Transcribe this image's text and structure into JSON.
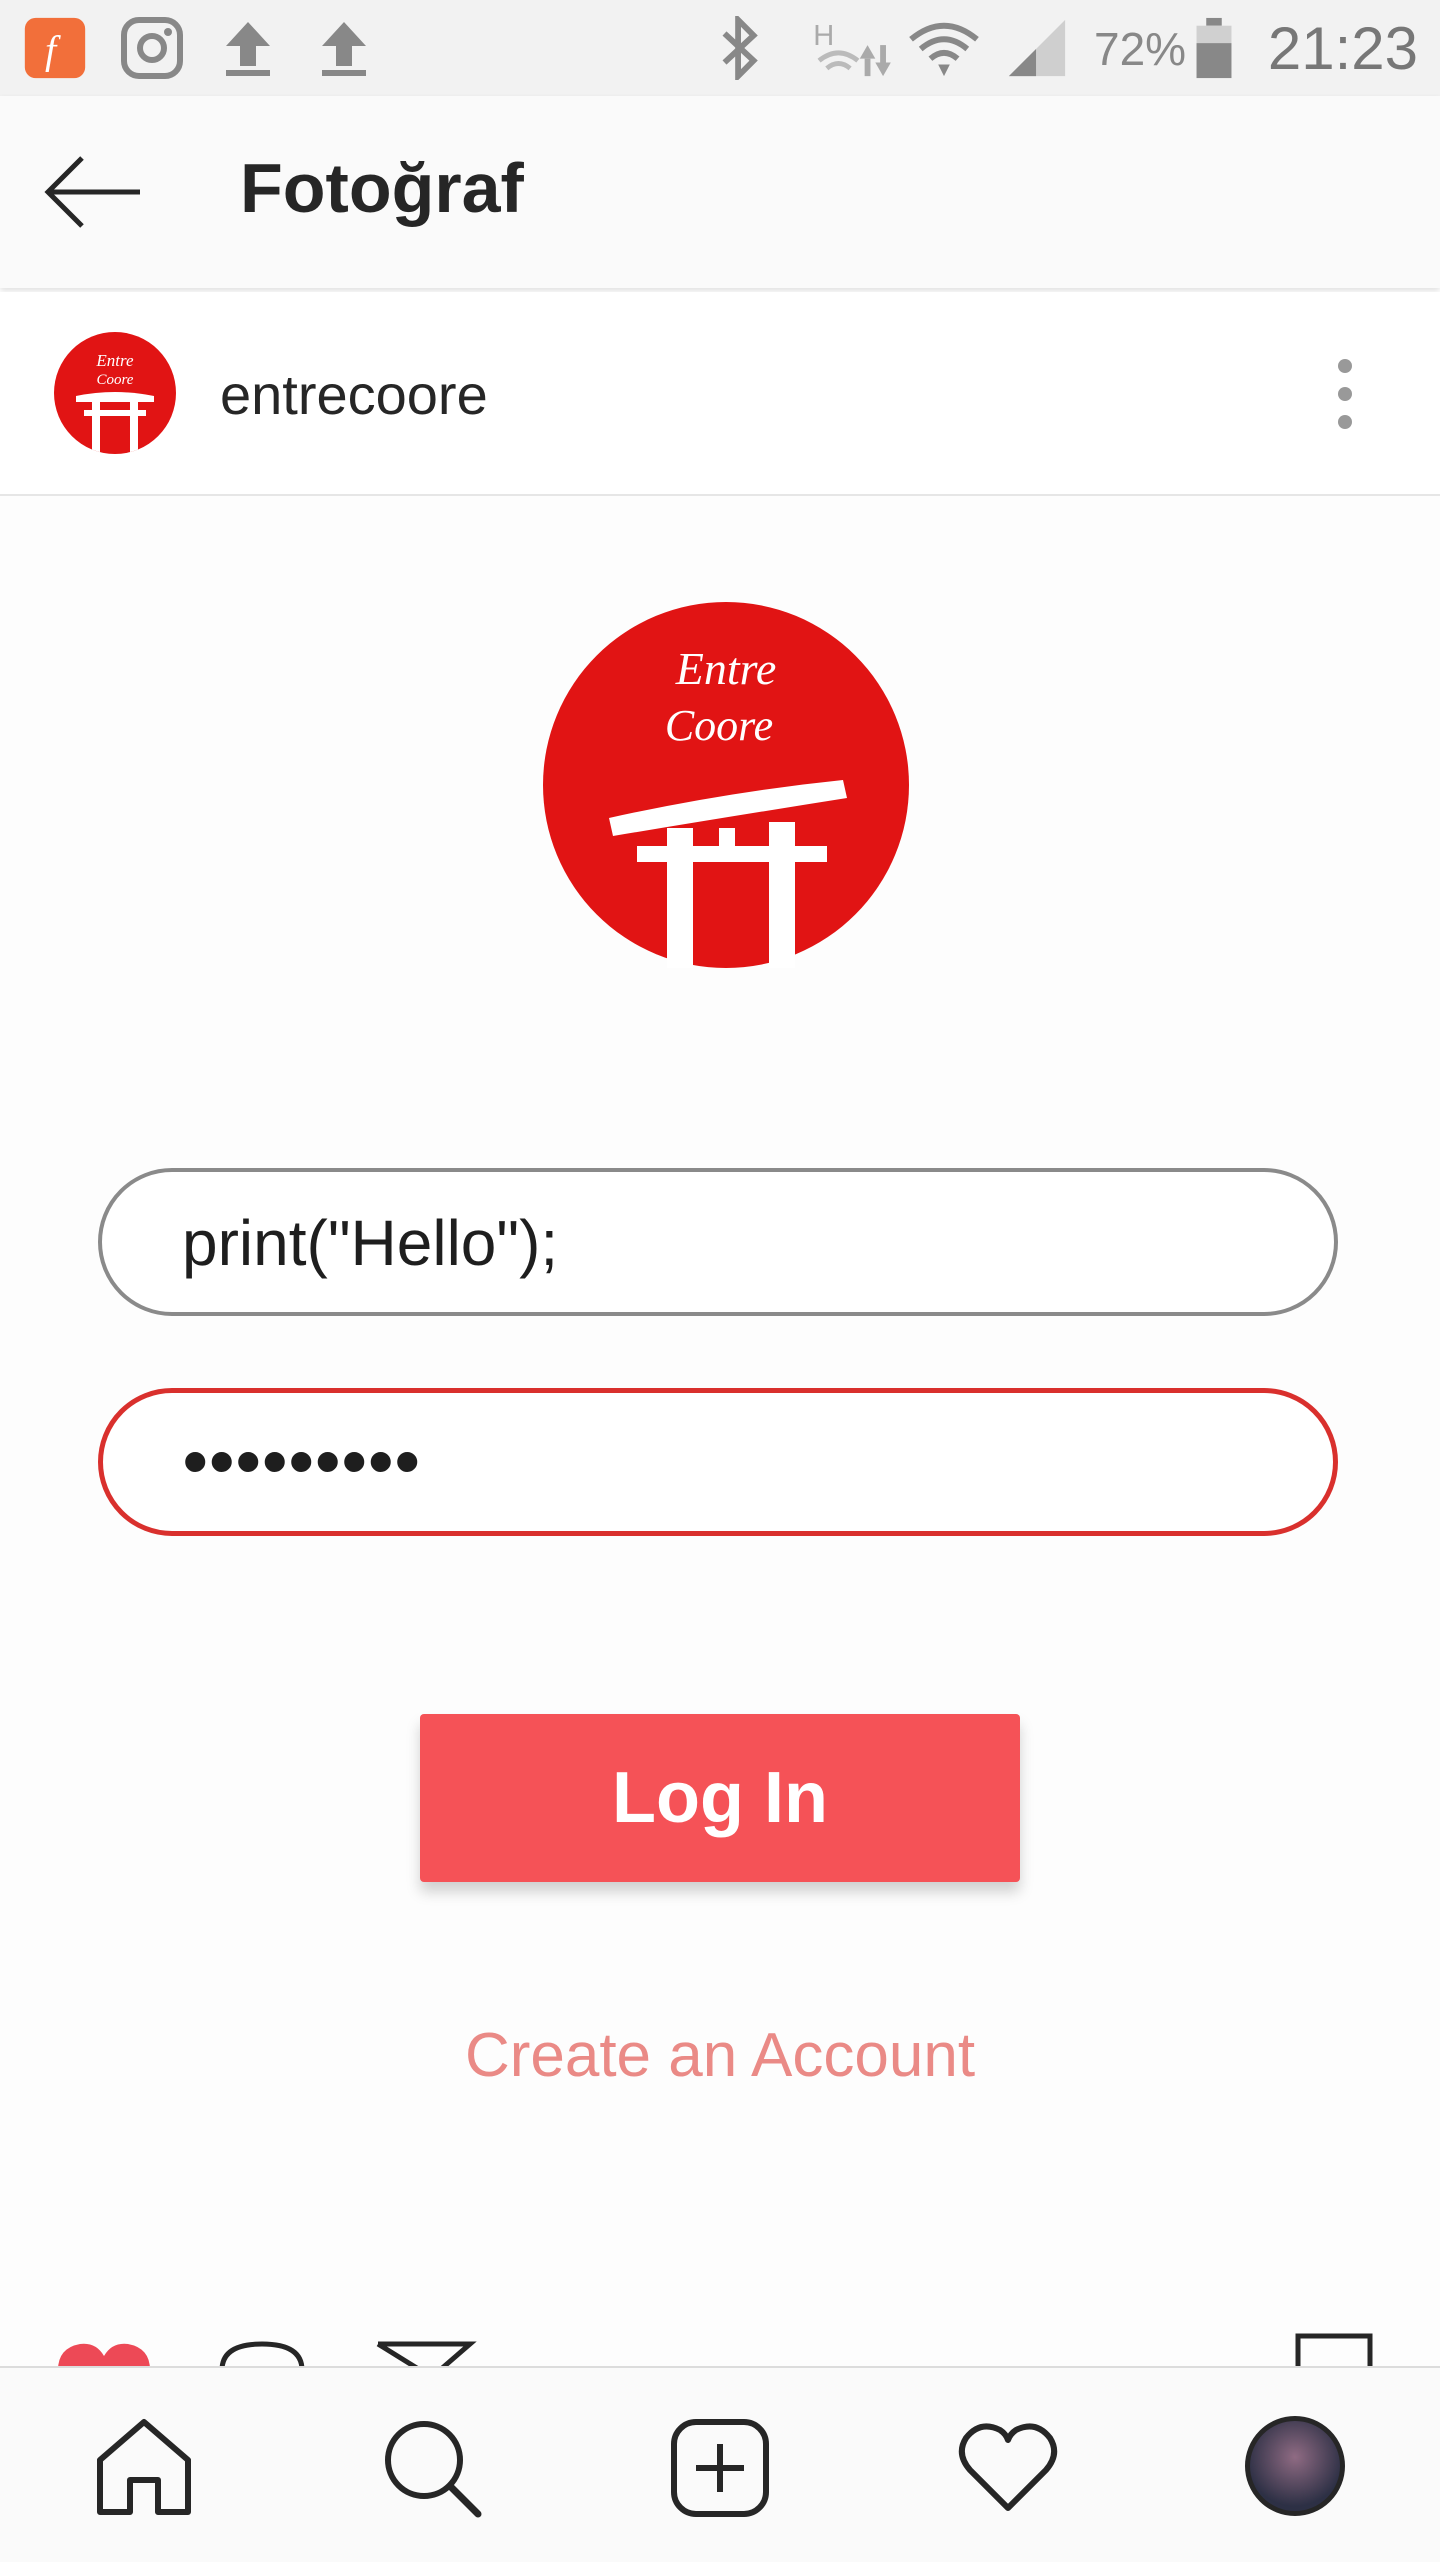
{
  "status_bar": {
    "battery_percent": "72%",
    "time": "21:23",
    "icons": [
      "flash-app-icon",
      "instagram-icon",
      "upload-icon",
      "upload-icon",
      "bluetooth-icon",
      "hspa-signal-icon",
      "wifi-icon",
      "cell-signal-icon",
      "battery-icon"
    ]
  },
  "header": {
    "title": "Fotoğraf",
    "back_icon": "arrow-left-icon"
  },
  "post": {
    "username": "entrecoore",
    "more_icon": "vertical-dots-icon",
    "logo_text_line1": "Entre",
    "logo_text_line2": "Coore",
    "username_field_value": "print(\"Hello\");",
    "password_field_value": "•••••••••",
    "login_button_label": "Log In",
    "create_account_label": "Create an Account"
  },
  "colors": {
    "logo_red": "#e11414",
    "button_red": "#f55257",
    "password_border": "#d9302d",
    "create_account": "#ea8a86"
  },
  "bottom_nav": {
    "items": [
      "home-icon",
      "search-icon",
      "add-post-icon",
      "heart-icon",
      "profile-avatar"
    ]
  }
}
